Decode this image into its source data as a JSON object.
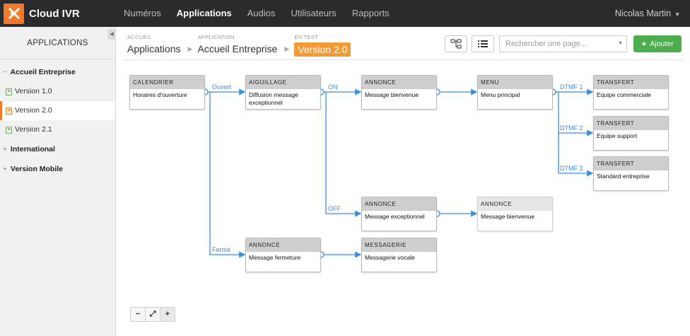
{
  "app": {
    "name": "Cloud IVR",
    "brand_color": "#f07a2a"
  },
  "nav": {
    "items": [
      {
        "label": "Numéros",
        "active": false
      },
      {
        "label": "Applications",
        "active": true
      },
      {
        "label": "Audios",
        "active": false
      },
      {
        "label": "Utilisateurs",
        "active": false
      },
      {
        "label": "Rapports",
        "active": false
      }
    ],
    "user": "Nicolas Martin"
  },
  "sidebar": {
    "title": "APPLICATIONS",
    "groups": [
      {
        "label": "Accueil Entreprise",
        "expanded": true,
        "toggle": "−",
        "items": [
          {
            "label": "Version 1.0",
            "active": false
          },
          {
            "label": "Version 2.0",
            "active": true
          },
          {
            "label": "Version 2.1",
            "active": false
          }
        ]
      },
      {
        "label": "International",
        "expanded": false,
        "toggle": "+"
      },
      {
        "label": "Version Mobile",
        "expanded": false,
        "toggle": "+"
      }
    ]
  },
  "breadcrumb": [
    {
      "small": "ACCUEIL",
      "label": "Applications"
    },
    {
      "small": "APPLICATION",
      "label": "Accueil Entreprise"
    },
    {
      "small": "EN TEST",
      "label": "Version 2.0",
      "badge": true
    }
  ],
  "toolbar": {
    "search_placeholder": "Rechercher une page...",
    "add_label": "Ajouter",
    "add_color": "#4cae4c"
  },
  "flow": {
    "nodes": {
      "calendrier": {
        "type": "CALENDRIER",
        "label": "Horaires d'ouverture"
      },
      "aiguillage": {
        "type": "AIGUILLAGE",
        "label": "Diffusion message exceptionnel"
      },
      "annonce1": {
        "type": "ANNONCE",
        "label": "Message bienvenue"
      },
      "menu": {
        "type": "MENU",
        "label": "Menu principal"
      },
      "transfert1": {
        "type": "TRANSFERT",
        "label": "Equipe commerciale"
      },
      "transfert2": {
        "type": "TRANSFERT",
        "label": "Equipe support"
      },
      "transfert3": {
        "type": "TRANSFERT",
        "label": "Standard entreprise"
      },
      "annonce2": {
        "type": "ANNONCE",
        "label": "Message exceptionnel"
      },
      "annonce3": {
        "type": "ANNONCE",
        "label": "Message bienvenue"
      },
      "annonce4": {
        "type": "ANNONCE",
        "label": "Message fermeture"
      },
      "messagerie": {
        "type": "MESSAGERIE",
        "label": "Messagerie vocale"
      }
    },
    "labels": {
      "ouvert": "Ouvert",
      "ferme": "Fermé",
      "on": "ON",
      "off": "OFF",
      "dtmf1": "DTMF 1",
      "dtmf2": "DTMF 2",
      "dtmf3": "DTMF 3"
    },
    "connector_color": "#3a8ee0"
  },
  "zoom": {
    "minus": "−",
    "fit": "⤢",
    "plus": "+"
  }
}
